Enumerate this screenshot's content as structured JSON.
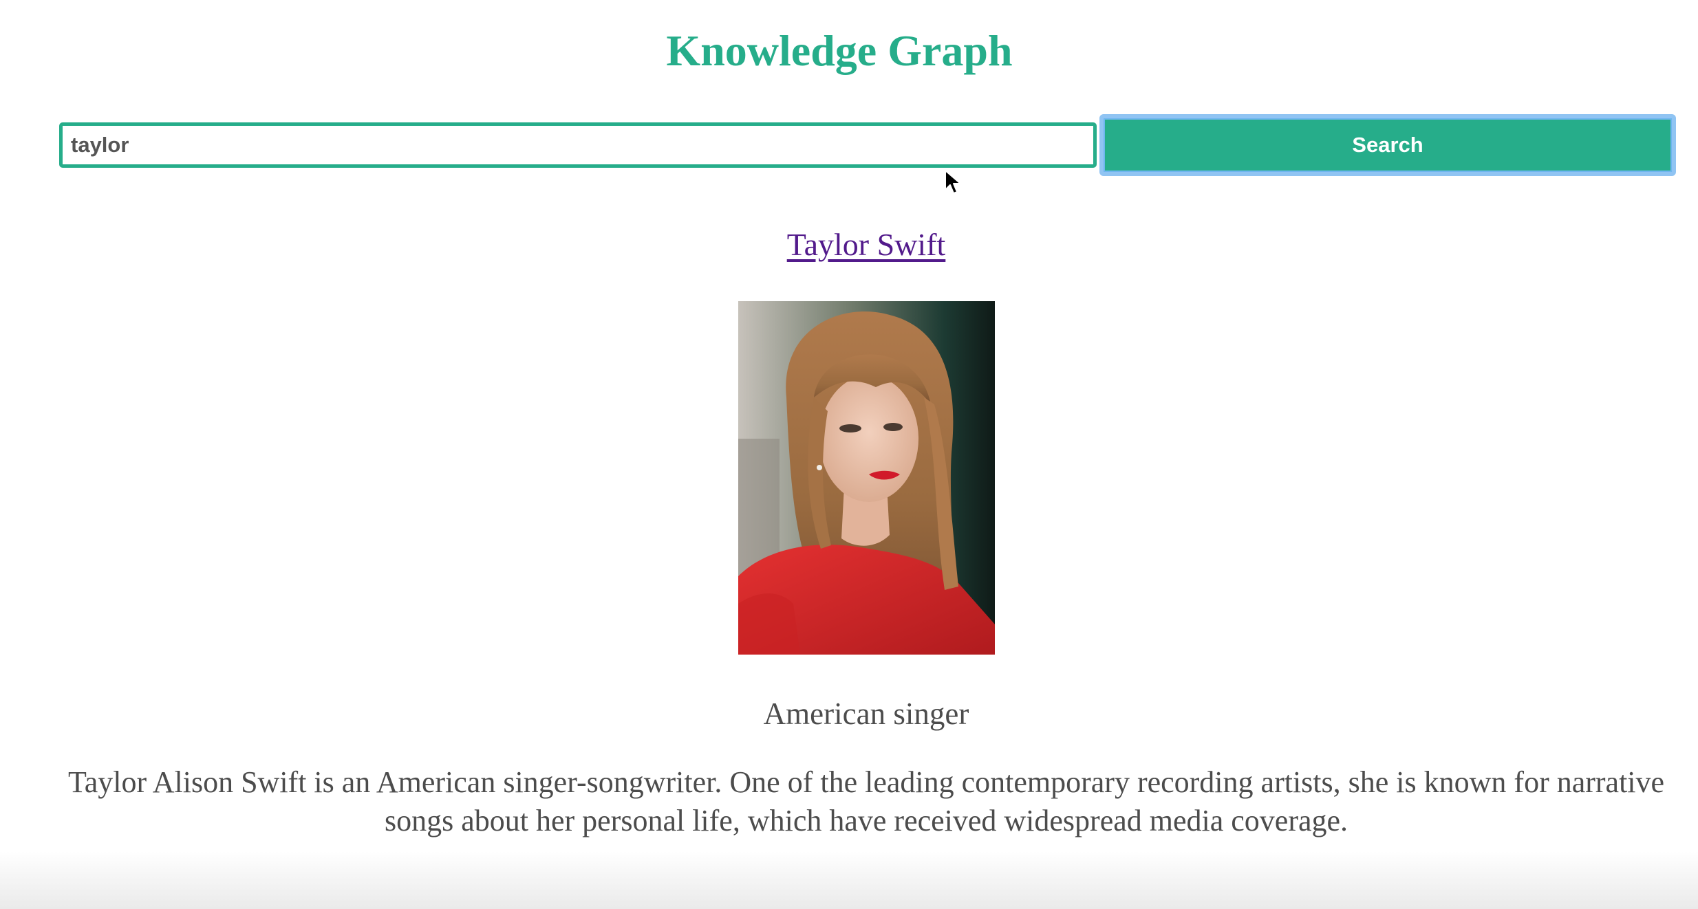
{
  "header": {
    "title": "Knowledge Graph"
  },
  "search": {
    "value": "taylor",
    "button_label": "Search"
  },
  "result": {
    "name": "Taylor Swift",
    "photo_icon": "portrait-photo",
    "subtitle": "American singer",
    "description": "Taylor Alison Swift is an American singer-songwriter. One of the leading contemporary recording artists, she is known for narrative songs about her personal life, which have received widespread media coverage."
  },
  "colors": {
    "accent": "#26ad8a",
    "link_visited": "#521a8b",
    "focus_ring": "#90c4f3",
    "body_text": "#4c4c4c"
  }
}
